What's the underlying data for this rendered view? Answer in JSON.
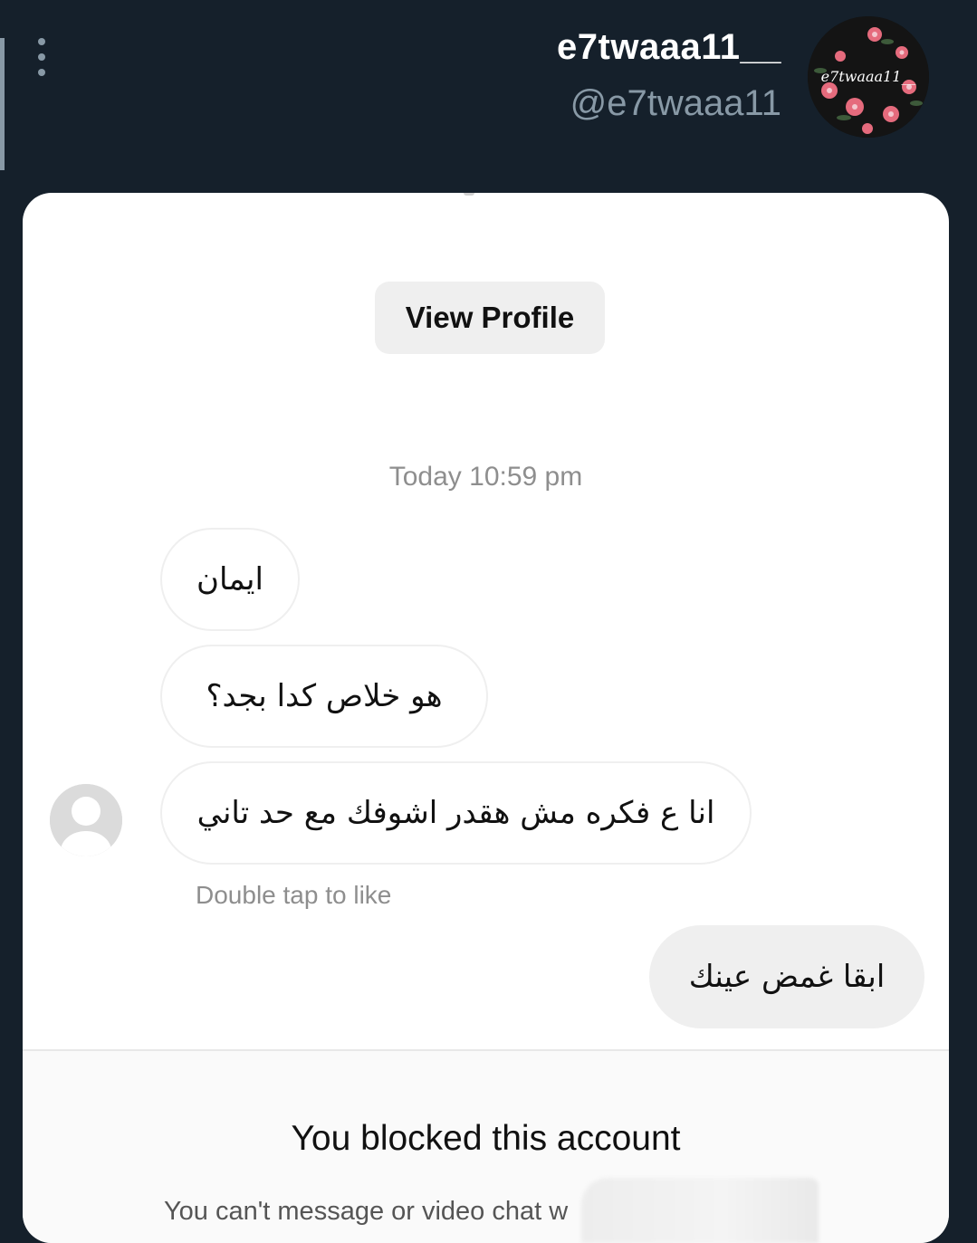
{
  "header": {
    "username": "e7twaaa11__",
    "handle": "@e7twaaa11",
    "avatar_text": "e7twaaa11__",
    "more_icon": "kebab-icon"
  },
  "chat": {
    "view_profile_label": "View Profile",
    "timestamp": "Today 10:59 pm",
    "incoming_messages": [
      "ايمان",
      "هو خلاص كدا بجد؟",
      "انا ع فكره مش هقدر اشوفك مع حد تاني"
    ],
    "double_tap_hint": "Double tap to like",
    "outgoing_messages": [
      "ابقا غمض عينك"
    ]
  },
  "blocked": {
    "title": "You blocked this account",
    "subtitle": "You can't message or video chat w"
  },
  "colors": {
    "background": "#15202b",
    "card": "#ffffff",
    "bubble_out": "#efefef",
    "muted_text": "#8e8e8e"
  }
}
